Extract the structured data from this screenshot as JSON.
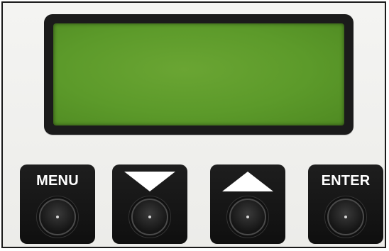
{
  "lcd": {
    "text": ""
  },
  "keys": [
    {
      "label": "MENU",
      "icon": "text-label"
    },
    {
      "label": "",
      "icon": "down-arrow-icon"
    },
    {
      "label": "",
      "icon": "up-arrow-icon"
    },
    {
      "label": "ENTER",
      "icon": "text-label"
    }
  ],
  "colors": {
    "lcd_green": "#5c9a2a",
    "key_black": "#141414",
    "label_white": "#ffffff",
    "panel": "#f0f0ee"
  }
}
